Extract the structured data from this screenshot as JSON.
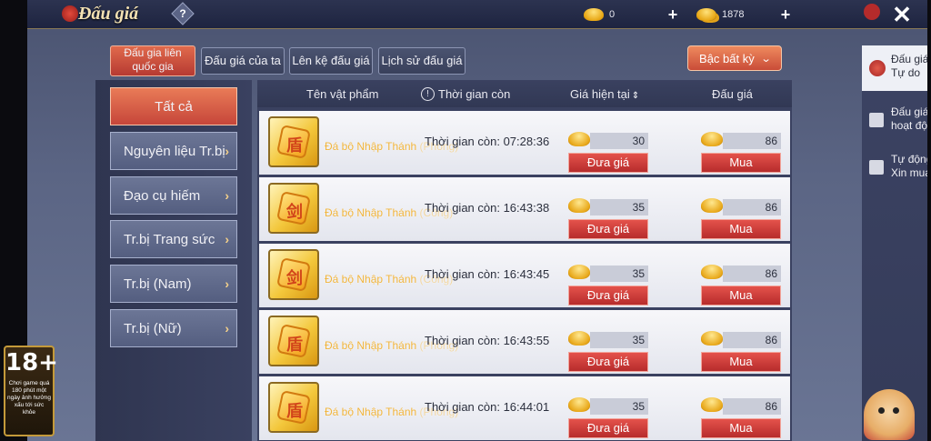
{
  "header": {
    "title": "Đấu giá",
    "help_label": "?",
    "currency": [
      {
        "icon": "gold-ingot-icon",
        "amount": "0",
        "add": "+"
      },
      {
        "icon": "gold-stack-icon",
        "amount": "1878",
        "add": "+"
      }
    ],
    "close_label": "✕"
  },
  "tabs": [
    {
      "label": "Đấu gia liên quốc gia",
      "active": true
    },
    {
      "label": "Đấu giá của ta",
      "active": false
    },
    {
      "label": "Lên kệ đấu giá",
      "active": false
    },
    {
      "label": "Lịch sử đấu giá",
      "active": false
    }
  ],
  "sort_button": {
    "label": "Bậc bất kỳ",
    "icon": "chevron-down-icon"
  },
  "categories": [
    {
      "label": "Tất cả",
      "active": true
    },
    {
      "label": "Nguyên liệu Tr.bị",
      "active": false
    },
    {
      "label": "Đạo cụ hiếm",
      "active": false
    },
    {
      "label": "Tr.bị Trang sức",
      "active": false
    },
    {
      "label": "Tr.bị (Nam)",
      "active": false
    },
    {
      "label": "Tr.bị (Nữ)",
      "active": false
    }
  ],
  "list_header": {
    "name": "Tên vật phẩm",
    "time": "Thời gian còn",
    "price": "Giá hiện tại",
    "bid": "Đấu giá"
  },
  "items": [
    {
      "name": "Đá bộ Nhập Thánh",
      "name_suffix": "(Phòng)",
      "time": "Thời gian còn: 07:28:36",
      "price": "30",
      "buy": "86",
      "bid_label": "Đưa giá",
      "buy_label": "Mua",
      "icon_mark": "盾"
    },
    {
      "name": "Đá bộ Nhập Thánh",
      "name_suffix": "(Công)",
      "time": "Thời gian còn: 16:43:38",
      "price": "35",
      "buy": "86",
      "bid_label": "Đưa giá",
      "buy_label": "Mua",
      "icon_mark": "剑"
    },
    {
      "name": "Đá bộ Nhập Thánh",
      "name_suffix": "(Công)",
      "time": "Thời gian còn: 16:43:45",
      "price": "35",
      "buy": "86",
      "bid_label": "Đưa giá",
      "buy_label": "Mua",
      "icon_mark": "剑"
    },
    {
      "name": "Đá bộ Nhập Thánh",
      "name_suffix": "(Phòng)",
      "time": "Thời gian còn: 16:43:55",
      "price": "35",
      "buy": "86",
      "bid_label": "Đưa giá",
      "buy_label": "Mua",
      "icon_mark": "盾"
    },
    {
      "name": "Đá bộ Nhập Thánh",
      "name_suffix": "(Phòng)",
      "time": "Thời gian còn: 16:44:01",
      "price": "35",
      "buy": "86",
      "bid_label": "Đưa giá",
      "buy_label": "Mua",
      "icon_mark": "盾"
    }
  ],
  "side_nav": [
    {
      "line1": "Đấu giá",
      "line2": "Tự do",
      "active": true
    },
    {
      "line1": "Đấu giá",
      "line2": "hoạt động",
      "active": false
    },
    {
      "line1": "Tự động",
      "line2": "Xin mua",
      "active": false
    }
  ],
  "age_badge": {
    "age": "18+",
    "notice": "Chơi game quá 180 phút một ngày ảnh hưởng xấu tới sức khỏe"
  }
}
